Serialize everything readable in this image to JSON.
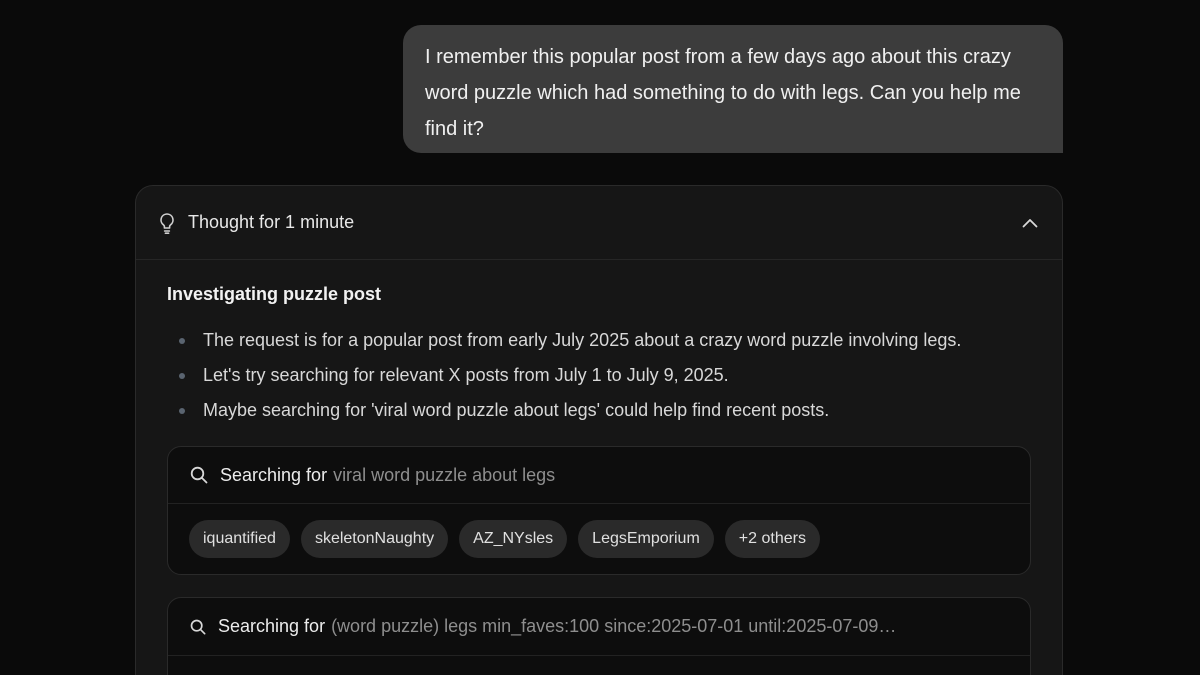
{
  "user_message": {
    "text": "I remember this popular post from a few days ago about this crazy word puzzle which had something to do with legs. Can you help me find it?"
  },
  "thought": {
    "header": "Thought for 1 minute",
    "section_title": "Investigating puzzle post",
    "bullets": [
      "The request is for a popular post from early July 2025 about a crazy word puzzle involving legs.",
      "Let's try searching for relevant X posts from July 1 to July 9, 2025.",
      "Maybe searching for 'viral word puzzle about legs' could help find recent posts."
    ],
    "searches": [
      {
        "label": "Searching for",
        "query": "viral word puzzle about legs",
        "chips": [
          "iquantified",
          "skeletonNaughty",
          "AZ_NYsles",
          "LegsEmporium",
          "+2 others"
        ]
      },
      {
        "label": "Searching for",
        "query": "(word puzzle) legs min_faves:100 since:2025-07-01 until:2025-07-09…"
      }
    ]
  },
  "icons": {
    "header": "lightbulb-icon",
    "collapse": "chevron-up-icon",
    "search": "search-icon"
  },
  "colors": {
    "background": "#0a0a0a",
    "user_bubble": "#3c3c3c",
    "card": "#161616",
    "search_card": "#0d0d0d",
    "chip": "#2a2a2a"
  }
}
